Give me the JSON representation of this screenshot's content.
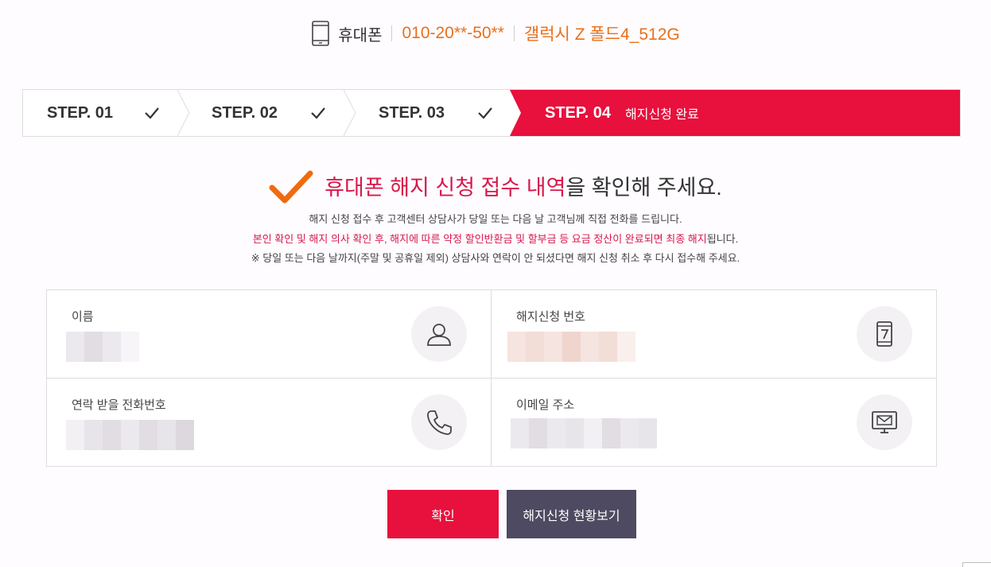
{
  "device": {
    "type": "휴대폰",
    "number": "010-20**-50**",
    "model": "갤럭시 Z 폴드4_512G"
  },
  "steps": [
    {
      "label": "STEP. 01",
      "done": true
    },
    {
      "label": "STEP. 02",
      "done": true
    },
    {
      "label": "STEP. 03",
      "done": true
    },
    {
      "label": "STEP. 04",
      "desc": "해지신청 완료",
      "active": true
    }
  ],
  "headline": {
    "highlight": "휴대폰 해지 신청 접수 내역",
    "rest": "을 확인해 주세요."
  },
  "notices": {
    "line1": "해지 신청 접수 후 고객센터 상담사가 당일 또는 다음 날 고객님께 직접 전화를 드립니다.",
    "line2_red": "본인 확인 및 해지 의사 확인 후, 해지에 따른 약정 할인반환금 및 할부금 등 요금 정산이 완료되면 최종 해지",
    "line2_dark": "됩니다.",
    "line3": "※ 당일 또는 다음 날까지(주말 및 공휴일 제외) 상담사와 연락이 안 되셨다면 해지 신청 취소 후 다시 접수해 주세요."
  },
  "info": {
    "name_label": "이름",
    "request_no_label": "해지신청 번호",
    "phone_label": "연락 받을 전화번호",
    "email_label": "이메일 주소"
  },
  "icons": {
    "device": "mobile-phone-icon",
    "check": "checkmark-icon",
    "name": "user-icon",
    "request_no": "phone-number-icon",
    "phone": "telephone-handset-icon",
    "email": "monitor-mail-icon"
  },
  "buttons": {
    "confirm": "확인",
    "status": "해지신청 현황보기"
  },
  "colors": {
    "accent": "#e8103c",
    "orange": "#e8701a",
    "dark_button": "#4e4a61"
  }
}
